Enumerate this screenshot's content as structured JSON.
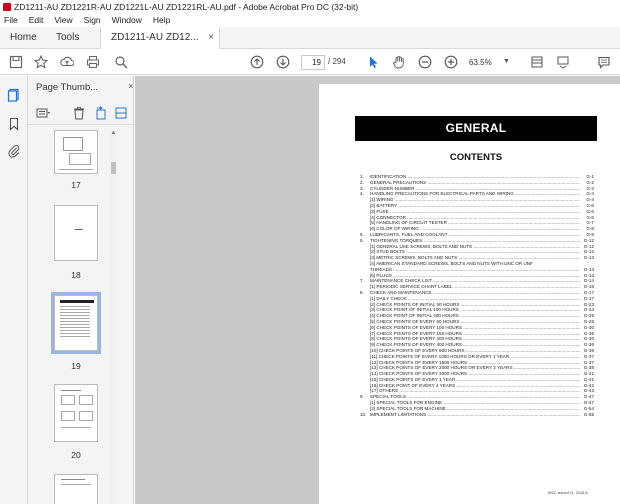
{
  "window": {
    "title": "ZD1211-AU ZD1221R-AU ZD1221L-AU ZD1221RL-AU.pdf - Adobe Acrobat Pro DC (32-bit)"
  },
  "menu": [
    "File",
    "Edit",
    "View",
    "Sign",
    "Window",
    "Help"
  ],
  "tabs": {
    "home": "Home",
    "tools": "Tools",
    "document": "ZD1211-AU ZD12...",
    "close": "×"
  },
  "toolbar": {
    "page_current": "19",
    "page_total": "/ 294",
    "zoom": "63.5%"
  },
  "panel": {
    "title": "Page Thumb...",
    "close": "×",
    "thumbnails": [
      {
        "label": "17"
      },
      {
        "label": "18"
      },
      {
        "label": "19"
      },
      {
        "label": "20"
      }
    ]
  },
  "document": {
    "heading": "GENERAL",
    "contents_title": "CONTENTS",
    "footer": "KiSC issued 11, 2016 A",
    "toc": [
      {
        "num": "1.",
        "text": "IDENTIFICATION",
        "page": "G-1"
      },
      {
        "num": "2.",
        "text": "GENERAL PRECAUTIONS",
        "page": "G-2"
      },
      {
        "num": "3.",
        "text": "CYLINDER NUMBER",
        "page": "G-3"
      },
      {
        "num": "4.",
        "text": "HANDLING PRECAUTIONS FOR ELECTRICAL PARTS AND WIRING",
        "page": "G-4"
      },
      {
        "num": "",
        "text": "[1]  WIRING",
        "page": "G-4"
      },
      {
        "num": "",
        "text": "[2]  BATTERY",
        "page": "G-6"
      },
      {
        "num": "",
        "text": "[3]  FUSE",
        "page": "G-6"
      },
      {
        "num": "",
        "text": "[4]  CONNECTOR",
        "page": "G-6"
      },
      {
        "num": "",
        "text": "[5]  HANDLING OF CIRCUIT TESTER",
        "page": "G-7"
      },
      {
        "num": "",
        "text": "[6]  COLOR OF WIRING",
        "page": "G-8"
      },
      {
        "num": "5.",
        "text": "LUBRICANTS, FUEL AND COOLANT",
        "page": "G-9"
      },
      {
        "num": "6.",
        "text": "TIGHTENING TORQUES",
        "page": "G-12"
      },
      {
        "num": "",
        "text": "[1]  GENERAL USE SCREWS, BOLTS AND NUTS",
        "page": "G-12"
      },
      {
        "num": "",
        "text": "[2]  STUD BOLTS",
        "page": "G-12"
      },
      {
        "num": "",
        "text": "[3]  METRIC SCREWS, BOLTS AND NUTS",
        "page": "G-13"
      },
      {
        "num": "",
        "text": "[4]  AMERICAN STANDARD SCREWS, BOLTS AND NUTS WITH UNC OR UNF",
        "page": "",
        "noleader": true
      },
      {
        "num": "",
        "text": "      THREADS",
        "page": "G-13"
      },
      {
        "num": "",
        "text": "[5]  PLUGS",
        "page": "G-13"
      },
      {
        "num": "7.",
        "text": "MAINTENANCE CHECK LIST",
        "page": "G-14"
      },
      {
        "num": "",
        "text": "[1]  PERIODIC SERVICE CHART LABEL",
        "page": "G-16"
      },
      {
        "num": "8.",
        "text": "CHECK AND MAINTENANCE",
        "page": "G-17"
      },
      {
        "num": "",
        "text": "[1]  DAILY CHECK",
        "page": "G-17"
      },
      {
        "num": "",
        "text": "[2]  CHECK POINTS OF INITIAL 50 HOURS",
        "page": "G-23"
      },
      {
        "num": "",
        "text": "[3]  CHECK POINT OF INITIAL 100 HOURS",
        "page": "G-24"
      },
      {
        "num": "",
        "text": "[4]  CHECK POINT OF INITIAL 400 HOURS",
        "page": "G-25"
      },
      {
        "num": "",
        "text": "[5]  CHECK POINTS OF EVERY 50 HOURS",
        "page": "G-26"
      },
      {
        "num": "",
        "text": "[6]  CHECK POINTS OF EVERY 100 HOURS",
        "page": "G-30"
      },
      {
        "num": "",
        "text": "[7]  CHECK POINTS OF EVERY 150 HOURS",
        "page": "G-35"
      },
      {
        "num": "",
        "text": "[8]  CHECK POINTS OF EVERY 200 HOURS",
        "page": "G-30"
      },
      {
        "num": "",
        "text": "[9]  CHECK POINTS OF EVERY 400 HOURS",
        "page": "G-36"
      },
      {
        "num": "",
        "text": "[10] CHECK POINTS OF EVERY 800 HOURS",
        "page": "G-36"
      },
      {
        "num": "",
        "text": "[11] CHECK POINTS OF EVERY 1000 HOURS OR EVERY 1 YEAR",
        "page": "G-37"
      },
      {
        "num": "",
        "text": "[12] CHECK POINTS OF EVERY 1500 HOURS",
        "page": "G-37"
      },
      {
        "num": "",
        "text": "[13] CHECK POINTS OF EVERY 2000 HOURS OR EVERY 2 YEARS",
        "page": "G-38"
      },
      {
        "num": "",
        "text": "[14] CHECK POINTS OF EVERY 3000 HOURS",
        "page": "G-41"
      },
      {
        "num": "",
        "text": "[15] CHECK POINTS OF EVERY 1 YEAR",
        "page": "G-41"
      },
      {
        "num": "",
        "text": "[16] CHECK POINT OF EVERY 4 YEARS",
        "page": "G-42"
      },
      {
        "num": "",
        "text": "[17] OTHERS",
        "page": "G-43"
      },
      {
        "num": "9.",
        "text": "SPECIAL TOOLS",
        "page": "G-47"
      },
      {
        "num": "",
        "text": "[1]  SPECIAL TOOLS FOR ENGINE",
        "page": "G-47"
      },
      {
        "num": "",
        "text": "[2]  SPECIAL TOOLS FOR MACHINE",
        "page": "G-54"
      },
      {
        "num": "10.",
        "text": "IMPLEMENT LIMITATIONS",
        "page": "G-55"
      }
    ]
  }
}
